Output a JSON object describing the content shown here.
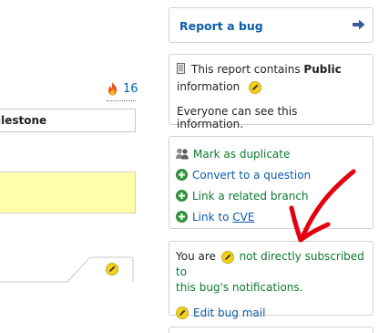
{
  "left": {
    "heat_count": "16",
    "milestone_label": "ilestone"
  },
  "report": {
    "label": "Report a bug"
  },
  "public_card": {
    "line_prefix": "This report contains ",
    "public_word": "Public",
    "line_suffix": "information",
    "everyone": "Everyone can see this information."
  },
  "actions": {
    "mark_duplicate": "Mark as duplicate",
    "convert": "Convert to a question",
    "link_branch": "Link a related branch",
    "link_to": "Link to ",
    "cve": "CVE"
  },
  "subscription": {
    "you_are": "You are",
    "not_subscribed": "not directly subscribed to",
    "notifications": "this bug's notifications.",
    "edit_mail": "Edit bug mail"
  },
  "colors": {
    "link_blue": "#0b5ca8",
    "action_green": "#0a7a2f",
    "highlight_yellow": "#ffffaa",
    "annotation_red": "#e3000f"
  }
}
